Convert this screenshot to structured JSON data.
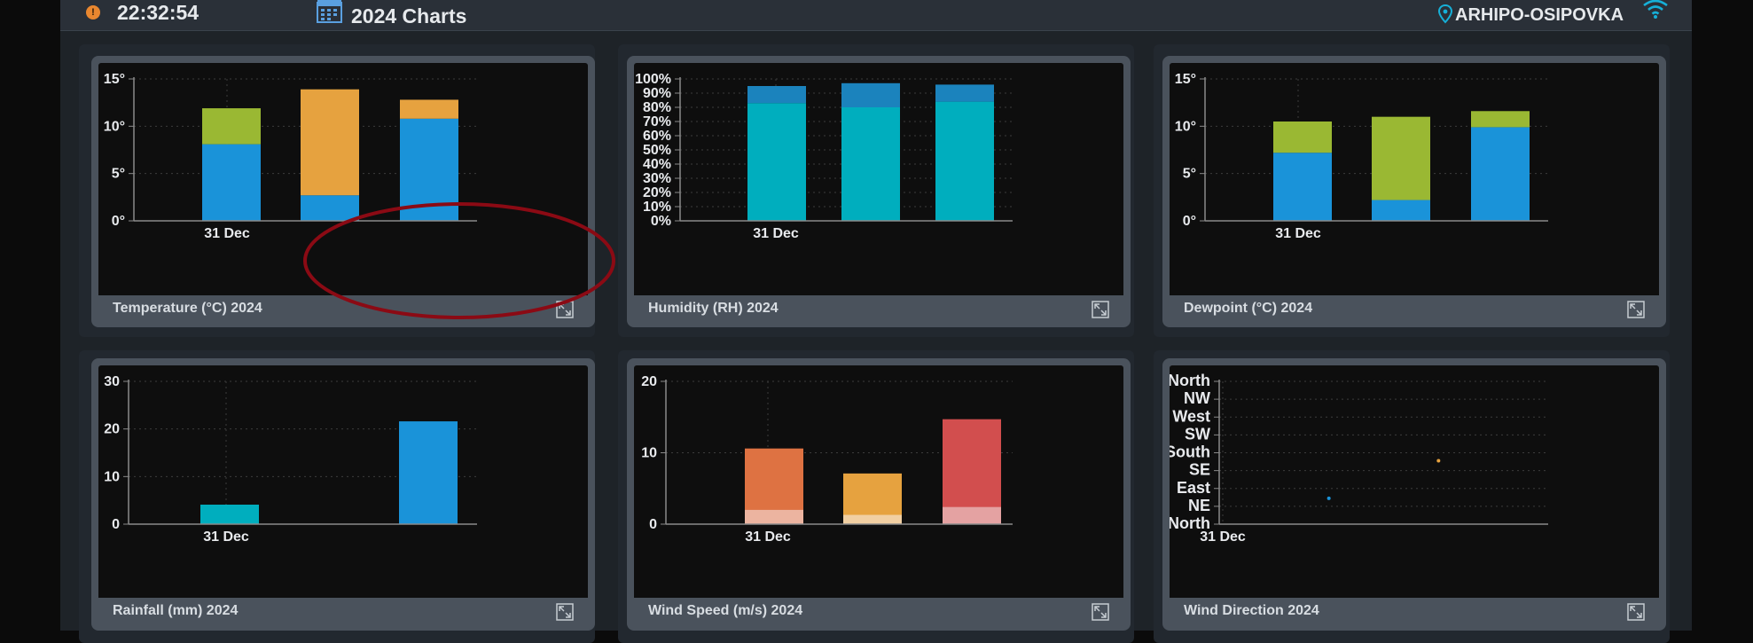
{
  "header": {
    "alert_badge": "!",
    "time": "22:32:54",
    "title": "2024 Charts",
    "location": "ARHIPO-OSIPOVKA"
  },
  "icons": [
    "alert-icon",
    "calendar-icon",
    "location-pin-icon",
    "wifi-icon",
    "expand-icon"
  ],
  "colors": {
    "blue": "#1a93d9",
    "green": "#9ab833",
    "orange": "#e6a23f",
    "teal": "#00aebe",
    "humidity_top": "#1b83bd",
    "wind_orange": "#de7242",
    "wind_orange_light": "#ecb4a0",
    "wind_yellow": "#e6a23f",
    "wind_yellow_light": "#f1cfa2",
    "wind_red": "#d24e4e",
    "wind_red_light": "#e4a2a2",
    "annotation": "#8b0a14"
  },
  "charts": {
    "temperature": {
      "caption": "Temperature (°C) 2024",
      "chart_data": {
        "type": "bar",
        "stacked": true,
        "categories": [
          "31 Dec",
          "",
          ""
        ],
        "x_tick_labels": [
          "31 Dec"
        ],
        "y_tick_labels": [
          "0°",
          "5°",
          "10°",
          "15°"
        ],
        "ylim": [
          0,
          15
        ],
        "grid": true,
        "series": [
          {
            "values": [
              8.1,
              2.7,
              10.8
            ]
          },
          {
            "values": [
              3.8,
              0,
              0
            ]
          },
          {
            "values": [
              0,
              11.2,
              2.0
            ]
          }
        ]
      }
    },
    "humidity": {
      "caption": "Humidity (RH) 2024",
      "chart_data": {
        "type": "bar",
        "stacked": true,
        "categories": [
          "31 Dec",
          "",
          ""
        ],
        "x_tick_labels": [
          "31 Dec"
        ],
        "y_tick_labels": [
          "0%",
          "10%",
          "20%",
          "30%",
          "40%",
          "50%",
          "60%",
          "70%",
          "80%",
          "90%",
          "100%"
        ],
        "ylim": [
          0,
          100
        ],
        "grid": true,
        "series": [
          {
            "values": [
              83,
              80,
              84
            ]
          },
          {
            "values": [
              12,
              17,
              12
            ]
          }
        ]
      }
    },
    "dewpoint": {
      "caption": "Dewpoint (°C) 2024",
      "chart_data": {
        "type": "bar",
        "stacked": true,
        "categories": [
          "31 Dec",
          "",
          ""
        ],
        "x_tick_labels": [
          "31 Dec"
        ],
        "y_tick_labels": [
          "0°",
          "5°",
          "10°",
          "15°"
        ],
        "ylim": [
          0,
          15
        ],
        "grid": true,
        "series": [
          {
            "values": [
              7.2,
              2.2,
              9.9
            ]
          },
          {
            "values": [
              3.3,
              8.8,
              1.7
            ]
          }
        ]
      }
    },
    "rainfall": {
      "caption": "Rainfall (mm) 2024",
      "chart_data": {
        "type": "bar",
        "categories": [
          "31 Dec",
          "",
          ""
        ],
        "x_tick_labels": [
          "31 Dec"
        ],
        "y_tick_labels": [
          "0",
          "10",
          "20",
          "30"
        ],
        "ylim": [
          0,
          30
        ],
        "grid": true,
        "series": [
          {
            "values": [
              4.1,
              0,
              21.6
            ]
          }
        ]
      }
    },
    "windspeed": {
      "caption": "Wind Speed (m/s) 2024",
      "chart_data": {
        "type": "bar",
        "categories": [
          "31 Dec",
          "",
          ""
        ],
        "x_tick_labels": [
          "31 Dec"
        ],
        "y_tick_labels": [
          "0",
          "10",
          "20"
        ],
        "ylim": [
          0,
          20
        ],
        "grid": true,
        "series": [
          {
            "values": [
              2.0,
              1.3,
              2.4
            ]
          },
          {
            "values": [
              10.6,
              7.1,
              14.7
            ]
          }
        ]
      }
    },
    "winddir": {
      "caption": "Wind Direction 2024",
      "chart_data": {
        "type": "scatter",
        "x_tick_labels": [
          "31 Dec"
        ],
        "y_tick_labels": [
          "North",
          "NE",
          "East",
          "SE",
          "South",
          "SW",
          "West",
          "NW",
          "North"
        ],
        "ylim": [
          0,
          360
        ],
        "xlim": [
          0,
          3
        ],
        "grid": true,
        "points": [
          {
            "x": 1.0,
            "y": 65,
            "color": "#1a93d9"
          },
          {
            "x": 2.0,
            "y": 160,
            "color": "#e6a23f"
          }
        ]
      }
    }
  }
}
